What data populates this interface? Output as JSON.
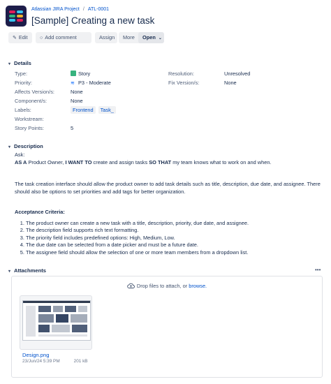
{
  "header": {
    "project": "Atlassian JIRA Project",
    "separator": "/",
    "issue_key": "ATL-0001",
    "title": "[Sample] Creating a new task"
  },
  "toolbar": {
    "edit": "Edit",
    "comment": "Add comment",
    "assign": "Assign",
    "more": "More",
    "status": "Open"
  },
  "details": {
    "heading": "Details",
    "type_label": "Type:",
    "type_value": "Story",
    "priority_label": "Priority:",
    "priority_value": "P3 - Moderate",
    "affects_label": "Affects Version/s:",
    "affects_value": "None",
    "component_label": "Component/s:",
    "component_value": "None",
    "labels_label": "Labels:",
    "labels": [
      "Frontend",
      "Task_"
    ],
    "workstream_label": "Workstream:",
    "story_points_label": "Story Points:",
    "story_points_value": "5",
    "resolution_label": "Resolution:",
    "resolution_value": "Unresolved",
    "fix_label": "Fix Version/s:",
    "fix_value": "None"
  },
  "description": {
    "heading": "Description",
    "ask": "Ask:",
    "story_as": "AS A",
    "story_role": " Product Owner, ",
    "story_want": "I WANT TO",
    "story_goal": " create and assign tasks ",
    "story_so": "SO THAT",
    "story_benefit": " my team knows what to work on and when.",
    "paragraph": "The task creation interface should allow the product owner to add task details such as title, description, due date, and assignee. There should also be options to set priorities and add tags for better organization.",
    "criteria_heading": "Acceptance Criteria:",
    "criteria": [
      "The product owner can create a new task with a title, description, priority, due date, and assignee.",
      "The description field supports rich text formatting.",
      "The priority field includes predefined options: High, Medium, Low.",
      "The due date can be selected from a date picker and must be a future date.",
      "The assignee field should allow the selection of one or more team members from a dropdown list."
    ]
  },
  "attachments": {
    "heading": "Attachments",
    "menu": "•••",
    "drop_text": "Drop files to attach, or",
    "browse": "browse.",
    "file_name": "Design.png",
    "file_date": "23/Jun/24 5:39 PM",
    "file_size": "201 kB"
  },
  "colors": {
    "link": "#0052cc",
    "text": "#172b4d",
    "story_icon": "#36b37e",
    "logo_bg": "#1d1d4a"
  }
}
